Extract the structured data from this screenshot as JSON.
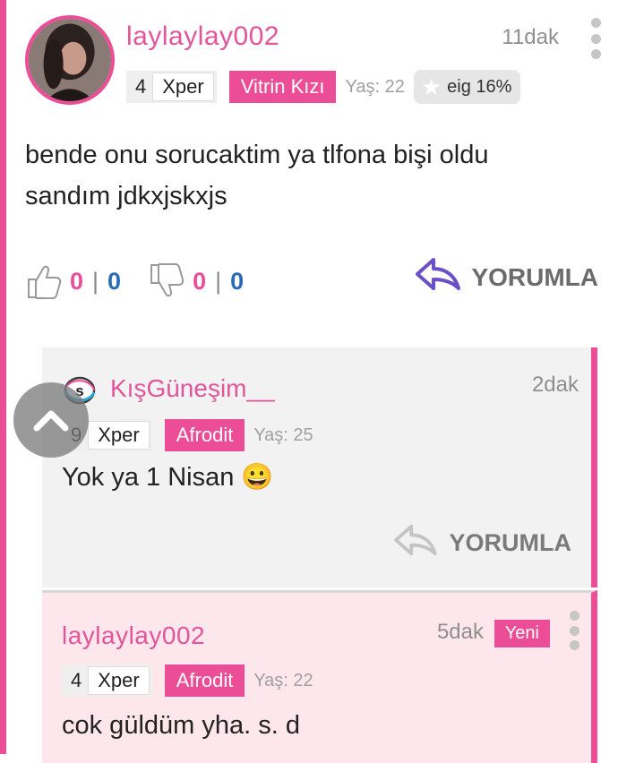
{
  "post": {
    "username": "laylaylay002",
    "time": "11dak",
    "level": "4",
    "xper": "Xper",
    "title": "Vitrin Kızı",
    "age": "Yaş: 22",
    "eig": "eig 16%",
    "text": "bende onu sorucaktim ya tlfona bişi oldu sandım jdkxjskxjs",
    "likes_pink": "0",
    "likes_blue": "0",
    "dislikes_pink": "0",
    "dislikes_blue": "0",
    "reply_label": "YORUMLA"
  },
  "comments": [
    {
      "logo_letter": "s",
      "username": "KışGüneşim__",
      "time": "2dak",
      "level": "9",
      "xper": "Xper",
      "title": "Afrodit",
      "age": "Yaş: 25",
      "text": "Yok ya 1 Nisan 😀",
      "reply_label": "YORUMLA"
    },
    {
      "username": "laylaylay002",
      "time": "5dak",
      "new_badge": "Yeni",
      "level": "4",
      "xper": "Xper",
      "title": "Afrodit",
      "age": "Yaş: 22",
      "text": "cok güldüm yha. s. d"
    }
  ],
  "colors": {
    "accent": "#ec4d97",
    "username": "#e2559a",
    "vote_blue": "#2a6bb6",
    "reply_purple": "#6a4fc8",
    "new_comment_bg": "#fde6ec"
  },
  "icons": [
    "kebab-menu-icon",
    "star-icon",
    "thumbs-up-icon",
    "thumbs-down-icon",
    "reply-arrow-icon",
    "scroll-up-chevron-icon",
    "user-logo-icon"
  ]
}
